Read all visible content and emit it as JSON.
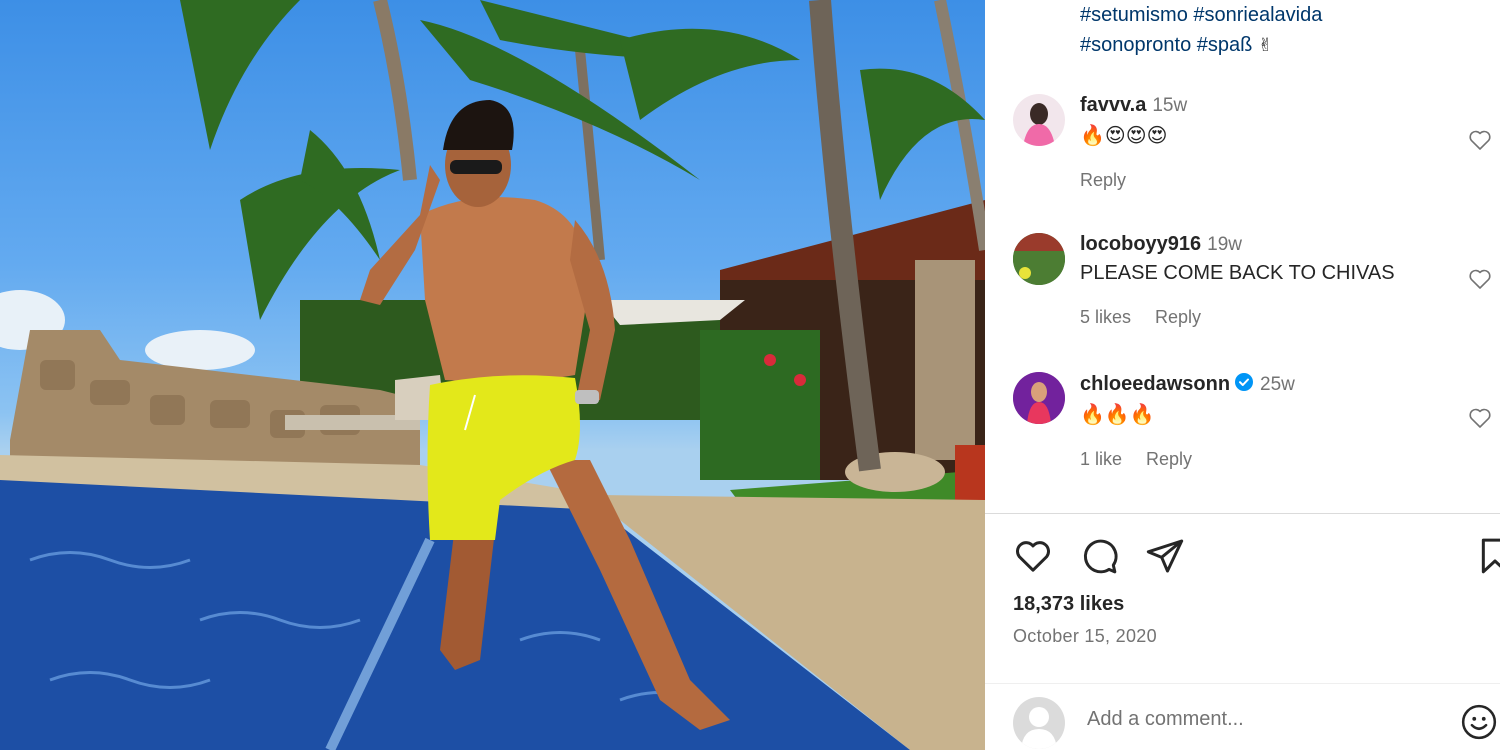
{
  "post": {
    "caption_lines": [
      "#setumismo #sonriealavida",
      "#sonopronto #spaß"
    ],
    "caption_emoji": "✌",
    "likes": "18,373 likes",
    "date": "October 15, 2020",
    "add_comment_placeholder": "Add a comment..."
  },
  "comments": [
    {
      "username": "favvv.a",
      "time": "15w",
      "text": "🔥😍😍😍",
      "likes": "",
      "reply": "Reply"
    },
    {
      "username": "locoboyy916",
      "time": "19w",
      "text": "PLEASE COME BACK TO CHIVAS",
      "likes": "5 likes",
      "reply": "Reply"
    },
    {
      "username": "chloeedawsonn",
      "time": "25w",
      "text": "🔥🔥🔥",
      "likes": "1 like",
      "reply": "Reply",
      "verified": true
    }
  ],
  "icons": {
    "like": "heart-icon",
    "comment": "comment-bubble-icon",
    "share": "send-icon",
    "save": "bookmark-icon",
    "emoji": "smiley-icon",
    "comment_like": "heart-icon",
    "verified": "verified-badge-icon"
  },
  "colors": {
    "link": "#00376b",
    "muted": "#737373",
    "verified": "#0095f6",
    "divider": "#dbdbdb"
  }
}
